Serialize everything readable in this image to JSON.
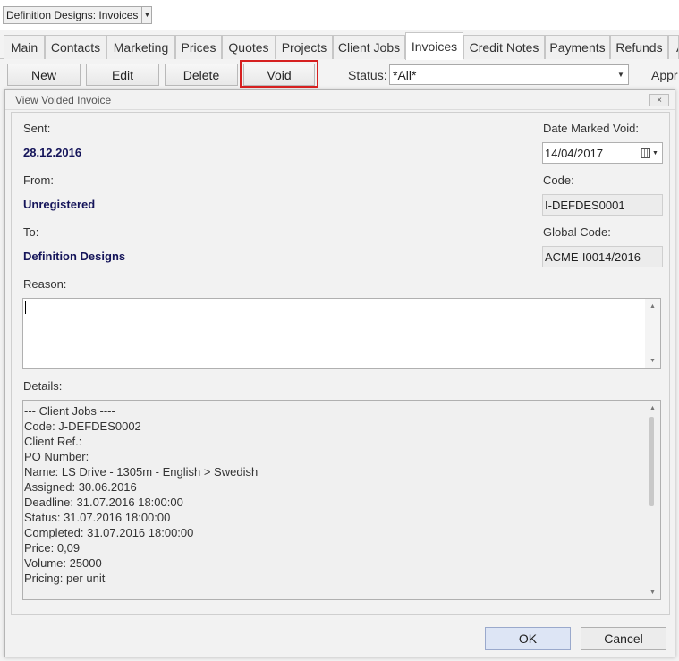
{
  "app": {
    "title": "Definition Designs: Invoices"
  },
  "tabs": [
    {
      "label": "Main"
    },
    {
      "label": "Contacts"
    },
    {
      "label": "Marketing"
    },
    {
      "label": "Prices"
    },
    {
      "label": "Quotes"
    },
    {
      "label": "Projects"
    },
    {
      "label": "Client Jobs"
    },
    {
      "label": "Invoices",
      "active": true
    },
    {
      "label": "Credit Notes"
    },
    {
      "label": "Payments"
    },
    {
      "label": "Refunds"
    },
    {
      "label": "A"
    }
  ],
  "toolbar": {
    "new_label": "New",
    "edit_label": "Edit",
    "delete_label": "Delete",
    "void_label": "Void",
    "status_label": "Status:",
    "status_value": "*All*",
    "approval_label": "Appr"
  },
  "dialog": {
    "title": "View Voided Invoice",
    "close_glyph": "×",
    "sent_label": "Sent:",
    "sent_value": "28.12.2016",
    "from_label": "From:",
    "from_value": "Unregistered",
    "to_label": "To:",
    "to_value": "Definition Designs",
    "date_void_label": "Date Marked Void:",
    "date_void_value": "14/04/2017",
    "code_label": "Code:",
    "code_value": "I-DEFDES0001",
    "global_code_label": "Global Code:",
    "global_code_value": "ACME-I0014/2016",
    "reason_label": "Reason:",
    "reason_value": "",
    "details_label": "Details:",
    "details_lines": [
      "--- Client Jobs ----",
      "Code: J-DEFDES0002",
      "Client Ref.:",
      "PO Number:",
      "Name: LS Drive - 1305m - English > Swedish",
      "Assigned: 30.06.2016",
      "Deadline: 31.07.2016 18:00:00",
      "Status: 31.07.2016 18:00:00",
      "Completed: 31.07.2016 18:00:00",
      "Price: 0,09",
      "Volume: 25000",
      "Pricing: per unit"
    ],
    "ok_label": "OK",
    "cancel_label": "Cancel"
  }
}
